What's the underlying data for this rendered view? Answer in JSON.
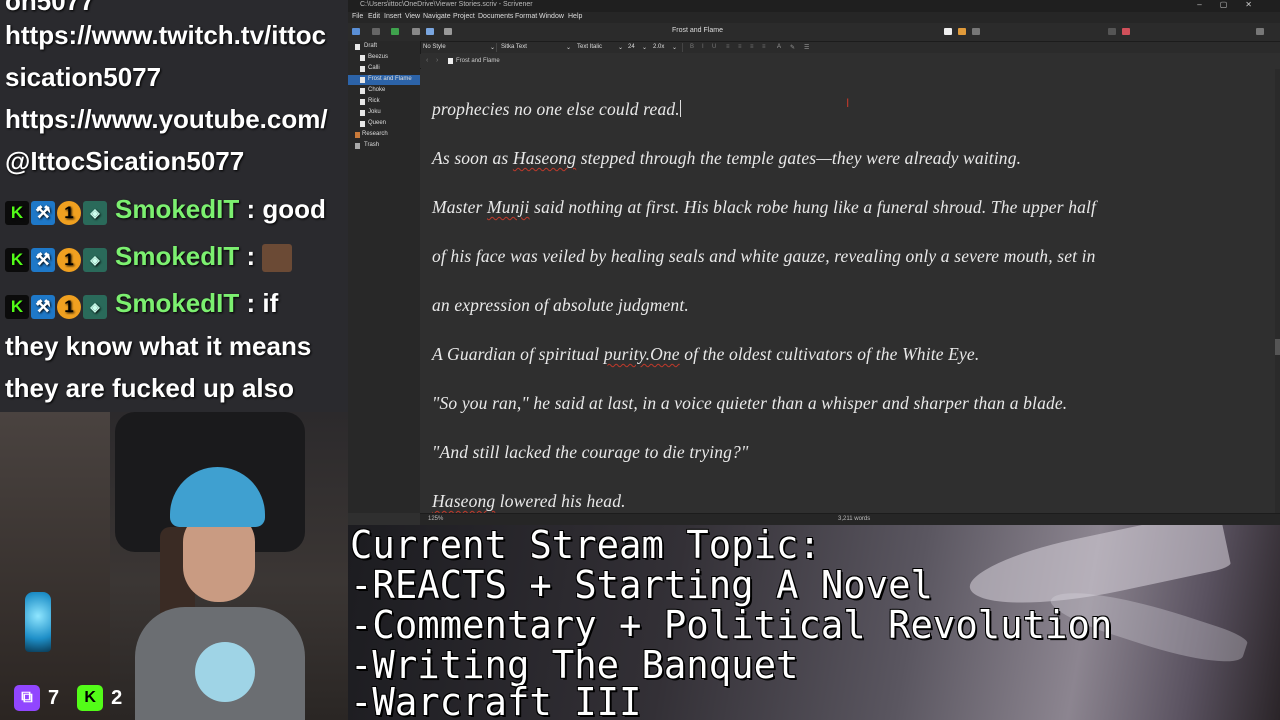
{
  "chat": {
    "lines": [
      {
        "text": "https://www.twitch.tv/ittoc"
      },
      {
        "text": "sication5077"
      },
      {
        "text": "https://www.youtube.com/"
      },
      {
        "text": "@IttocSication5077"
      }
    ],
    "messages": [
      {
        "username": "SmokedIT",
        "message": "good"
      },
      {
        "username": "SmokedIT",
        "message": ""
      },
      {
        "username": "SmokedIT",
        "message": "if"
      }
    ],
    "continued": [
      "they know what it means",
      "they are fucked up also"
    ]
  },
  "stream_stats": {
    "twitch_viewers": "7",
    "kick_viewers": "2"
  },
  "scrivener": {
    "window_path": "C:\\Users\\ittoc\\OneDrive\\Viewer Stories.scriv - Scrivener",
    "menu": [
      "File",
      "Edit",
      "Insert",
      "View",
      "Navigate",
      "Project",
      "Documents",
      "Format",
      "Window",
      "Help"
    ],
    "document_title": "Frost and Flame",
    "format": {
      "style": "No Style",
      "font": "Sitka Text",
      "face": "Text Italic",
      "size": "24",
      "spacing": "2.0x"
    },
    "binder": [
      {
        "label": "Draft",
        "level": 0,
        "folder": true
      },
      {
        "label": "Beezus",
        "level": 1
      },
      {
        "label": "Calli",
        "level": 1
      },
      {
        "label": "Frost and Flame",
        "level": 1,
        "selected": true
      },
      {
        "label": "Choke",
        "level": 1
      },
      {
        "label": "Rick",
        "level": 1
      },
      {
        "label": "Joku",
        "level": 1
      },
      {
        "label": "Queen",
        "level": 1
      },
      {
        "label": "Research",
        "level": 0,
        "folder": true
      },
      {
        "label": "Trash",
        "level": 0
      }
    ],
    "breadcrumb": "Frost and Flame",
    "editor": {
      "p1": "prophecies no one else could read.",
      "p2a": "As soon as ",
      "p2b": "Haseong",
      "p2c": " stepped through the temple gates—they were already waiting.",
      "p3a": "Master ",
      "p3b": "Munji",
      "p3c": " said nothing at first. His black robe hung like a funeral shroud. The upper half",
      "p4": "of his face was veiled by healing seals and white gauze, revealing only a severe mouth, set in",
      "p5": "an expression of absolute judgment.",
      "p6a": "A Guardian of spiritual ",
      "p6b": "purity.One",
      "p6c": " of the oldest cultivators of the White Eye.",
      "p7": "\"So you ran,\" he said at last, in a voice quieter than a whisper and sharper than a blade.",
      "p8": "\"And still lacked the courage to die trying?\"",
      "p9a": "Haseong",
      "p9b": " lowered his head."
    },
    "zoom": "125%",
    "word_count": "3,211 words"
  },
  "topic": {
    "header": "Current Stream Topic:",
    "items": [
      "-REACTS + Starting A Novel",
      "-Commentary + Political Revolution",
      "-Writing The Banquet",
      "-Warcraft III"
    ]
  }
}
